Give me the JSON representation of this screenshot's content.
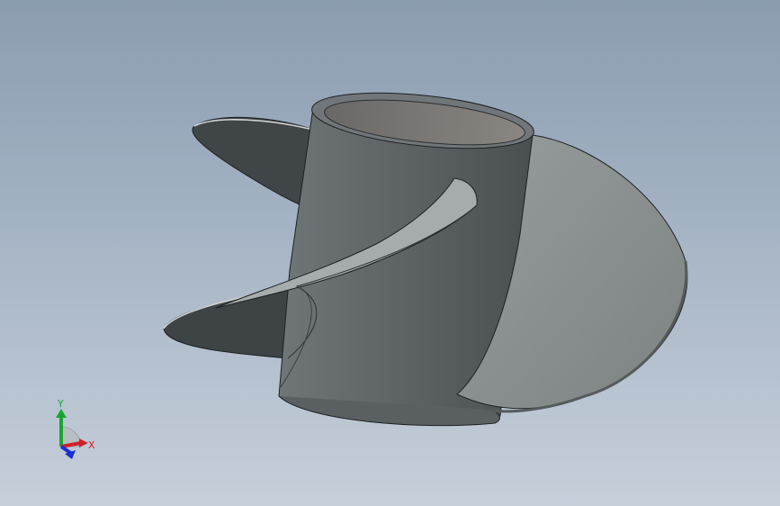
{
  "viewport": {
    "background_top": "#8a9cb0",
    "background_bottom": "#c6cfda"
  },
  "model": {
    "part": "propeller-impeller",
    "blade_color_dark": "#3f4446",
    "blade_color_light": "#8e9394",
    "hub_color": "#5f6567"
  },
  "triad": {
    "x_label": "X",
    "y_label": "Y",
    "x_color": "#d0202a",
    "y_color": "#1aa531",
    "z_color": "#1d2fd0"
  }
}
